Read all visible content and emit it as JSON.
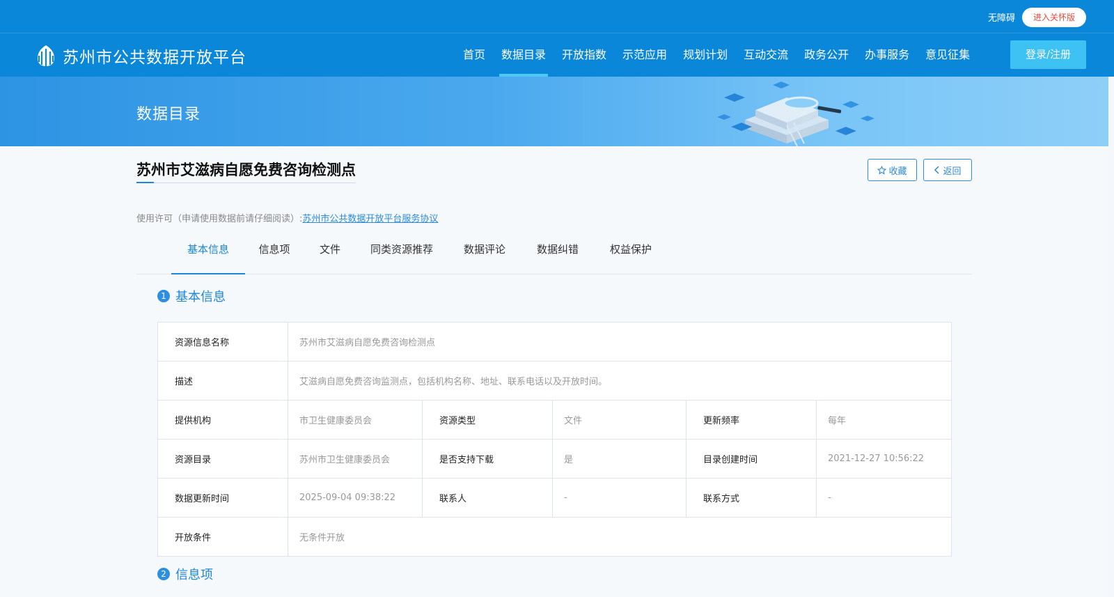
{
  "topbar": {
    "accessibility": "无障碍",
    "care_mode": "进入关怀版"
  },
  "logo": {
    "site_name": "苏州市公共数据开放平台"
  },
  "nav": {
    "items": [
      "首页",
      "数据目录",
      "开放指数",
      "示范应用",
      "规划计划",
      "互动交流",
      "政务公开",
      "办事服务",
      "意见征集"
    ],
    "active_index": 1,
    "login": "登录/注册"
  },
  "banner": {
    "title": "数据目录"
  },
  "detail": {
    "title": "苏州市艾滋病自愿免费咨询检测点",
    "favorite": "收藏",
    "back": "返回",
    "license_prefix": "使用许可（申请使用数据前请仔细阅读）:",
    "license_link": "苏州市公共数据开放平台服务协议"
  },
  "tabs": [
    "基本信息",
    "信息项",
    "文件",
    "同类资源推荐",
    "数据评论",
    "数据纠错",
    "权益保护"
  ],
  "sections": [
    {
      "num": "1",
      "title": "基本信息"
    },
    {
      "num": "2",
      "title": "信息项"
    }
  ],
  "info": {
    "name_label": "资源信息名称",
    "name": "苏州市艾滋病自愿免费咨询检测点",
    "desc_label": "描述",
    "desc": "艾滋病自愿免费咨询监测点，包括机构名称、地址、联系电话以及开放时间。",
    "provider_label": "提供机构",
    "provider": "市卫生健康委员会",
    "type_label": "资源类型",
    "type": "文件",
    "freq_label": "更新频率",
    "freq": "每年",
    "catalog_label": "资源目录",
    "catalog": "苏州市卫生健康委员会",
    "download_label": "是否支持下载",
    "download": "是",
    "created_label": "目录创建时间",
    "created": "2021-12-27 10:56:22",
    "updated_label": "数据更新时间",
    "updated": "2025-09-04 09:38:22",
    "contact_label": "联系人",
    "contact": "-",
    "method_label": "联系方式",
    "method": "-",
    "open_label": "开放条件",
    "open": "无条件开放"
  },
  "colors": {
    "primary": "#0a87d9",
    "accent": "#1d86da",
    "login_bg": "#3ec1f3",
    "care_text": "#e34a3a"
  }
}
